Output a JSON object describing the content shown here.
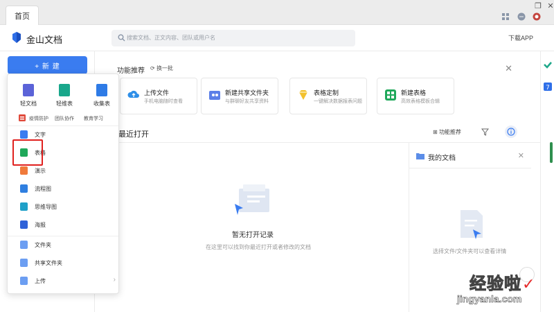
{
  "titlebar": {
    "tab_label": "首页",
    "restore": "❐",
    "close": "✕"
  },
  "header": {
    "brand": "金山文档",
    "search_placeholder": "搜索文档、正文内容、团队或用户名",
    "download": "下载APP"
  },
  "sidebar": {
    "new_label": "+ 新 建"
  },
  "new_menu": {
    "quick": [
      {
        "label": "轻文档",
        "color": "#5b63d8"
      },
      {
        "label": "轻维表",
        "color": "#19a78b"
      },
      {
        "label": "收集表",
        "color": "#2e7be6"
      }
    ],
    "templates": [
      "疫情防护",
      "团队协作",
      "教育学习"
    ],
    "items": [
      {
        "label": "文字",
        "color": "#3b7cf0"
      },
      {
        "label": "表格",
        "color": "#1fa85a"
      },
      {
        "label": "演示",
        "color": "#f07a3b"
      },
      {
        "label": "流程图",
        "color": "#2f7fe0"
      },
      {
        "label": "思维导图",
        "color": "#1fa0c8"
      },
      {
        "label": "海报",
        "color": "#2f62d8"
      }
    ],
    "bottom": [
      {
        "label": "文件夹",
        "color": "#6c9ef2"
      },
      {
        "label": "共享文件夹",
        "color": "#6c9ef2"
      },
      {
        "label": "上传",
        "color": "#6c9ef2",
        "chevron": "›"
      }
    ]
  },
  "main": {
    "feature_title": "功能推荐",
    "refresh": "换一批",
    "close": "✕",
    "cards": [
      {
        "title": "上传文件",
        "subtitle": "手机电脑随时查看",
        "color": "#2f8fe8"
      },
      {
        "title": "新建共享文件夹",
        "subtitle": "与群聊好友共享资料",
        "color": "#5b7fe8"
      },
      {
        "title": "表格定制",
        "subtitle": "一键解决数据报表问题",
        "color": "#f2c12e"
      },
      {
        "title": "新建表格",
        "subtitle": "高效表格模板合辑",
        "color": "#1fa85a"
      }
    ],
    "recent_title": "最近打开",
    "feature_recommend": "功能推荐",
    "empty_title": "暂无打开记录",
    "empty_sub": "在这里可以找到你最近打开或者修改的文档"
  },
  "doc_panel": {
    "title": "我的文档",
    "close": "✕",
    "empty": "选择文件/文件夹可以查看详情"
  },
  "watermark": {
    "text": "经验啦",
    "url": "jingyanla.com",
    "check": "✓"
  }
}
